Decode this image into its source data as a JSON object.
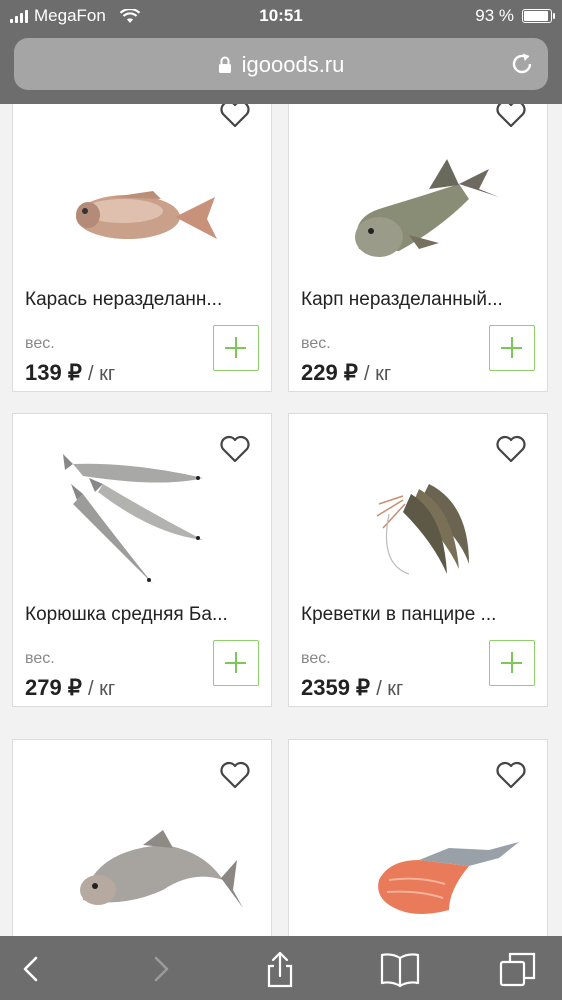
{
  "status_bar": {
    "carrier": "MegaFon",
    "time": "10:51",
    "battery": "93 %",
    "battery_level": 0.93
  },
  "browser": {
    "url": "igooods.ru"
  },
  "products": [
    {
      "name": "Карась неразделанн...",
      "weight_label": "вес.",
      "price": "139 ₽",
      "unit": "/ кг",
      "favorite": false
    },
    {
      "name": "Карп неразделанный...",
      "weight_label": "вес.",
      "price": "229 ₽",
      "unit": "/ кг",
      "favorite": false
    },
    {
      "name": "Корюшка средняя Ба...",
      "weight_label": "вес.",
      "price": "279 ₽",
      "unit": "/ кг",
      "favorite": false
    },
    {
      "name": "Креветки в панцире ...",
      "weight_label": "вес.",
      "price": "2359 ₽",
      "unit": "/ кг",
      "favorite": false
    },
    {
      "name": "",
      "weight_label": "",
      "price": "",
      "unit": "",
      "favorite": false
    },
    {
      "name": "",
      "weight_label": "",
      "price": "",
      "unit": "",
      "favorite": false
    }
  ],
  "toolbar": {
    "buttons": [
      "back-icon",
      "forward-icon",
      "share-icon",
      "bookmarks-icon",
      "tabs-icon"
    ]
  }
}
